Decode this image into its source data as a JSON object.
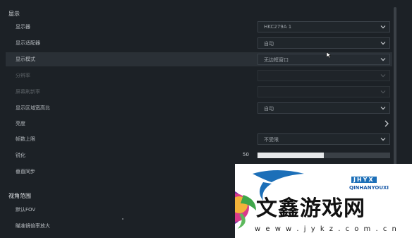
{
  "sections": {
    "display_title": "显示",
    "view_title": "视角范围"
  },
  "settings": [
    {
      "label": "显示器",
      "value": "HKC279A 1"
    },
    {
      "label": "显示适配器",
      "value": "自动"
    },
    {
      "label": "显示模式",
      "value": "无边框窗口"
    },
    {
      "label": "分辨率",
      "value": ""
    },
    {
      "label": "屏幕刷新率",
      "value": ""
    },
    {
      "label": "显示区域宽高比",
      "value": "自动"
    },
    {
      "label": "亮度",
      "value": ""
    },
    {
      "label": "帧数上限",
      "value": "不受限"
    },
    {
      "label": "锐化",
      "value": "50"
    },
    {
      "label": "垂直同步",
      "value": ""
    }
  ],
  "view_settings": [
    {
      "label": "默认FOV"
    },
    {
      "label": "瞄准镜倍率放大"
    }
  ],
  "sharpen_level": 0.5,
  "watermark": {
    "brand": "文鑫游戏网",
    "badge": "JHYX",
    "pinyin": "QINHANYOUXI",
    "url": "w e w w . j y k z . c o m . c n"
  },
  "colors": {
    "background": "#1c2126",
    "highlight_row": "#2a3036",
    "slider_fill": "#e6e8ea"
  },
  "icons": [
    "chevron-down-icon",
    "chevron-right-icon",
    "mouse-cursor-icon",
    "brand-logo-icon"
  ]
}
